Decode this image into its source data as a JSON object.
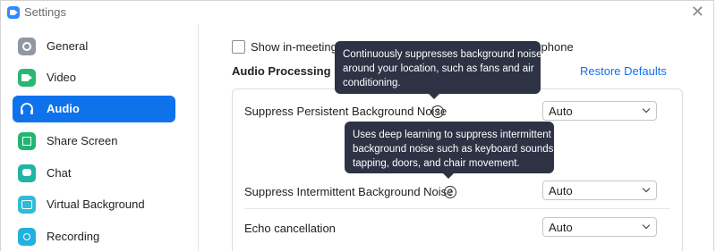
{
  "window": {
    "title": "Settings",
    "close_glyph": "✕"
  },
  "sidebar": {
    "items": [
      {
        "label": "General",
        "icon": "gear-icon",
        "active": false
      },
      {
        "label": "Video",
        "icon": "video-camera-icon",
        "active": false
      },
      {
        "label": "Audio",
        "icon": "headphones-icon",
        "active": true
      },
      {
        "label": "Share Screen",
        "icon": "share-screen-icon",
        "active": false
      },
      {
        "label": "Chat",
        "icon": "chat-bubble-icon",
        "active": false
      },
      {
        "label": "Virtual Background",
        "icon": "virtual-background-icon",
        "active": false
      },
      {
        "label": "Recording",
        "icon": "record-icon",
        "active": false
      }
    ],
    "active_color": "#0e72ed"
  },
  "main": {
    "checkbox_label_start": "Show in-meeting",
    "checkbox_label_end": "rophone",
    "section_title": "Audio Processing",
    "restore_defaults": "Restore Defaults",
    "rows": [
      {
        "label": "Suppress Persistent Background Noise",
        "value": "Auto"
      },
      {
        "label": "Suppress Intermittent Background Noise",
        "value": "Auto"
      },
      {
        "label": "Echo cancellation",
        "value": "Auto"
      }
    ],
    "help_glyph": "?"
  },
  "tooltips": {
    "persistent": [
      "Continuously suppresses background noise",
      "around your location, such as fans and air",
      "conditioning."
    ],
    "intermittent": [
      "Uses deep learning to suppress intermittent",
      "background noise such as keyboard sounds,",
      "tapping, doors, and chair movement."
    ]
  }
}
